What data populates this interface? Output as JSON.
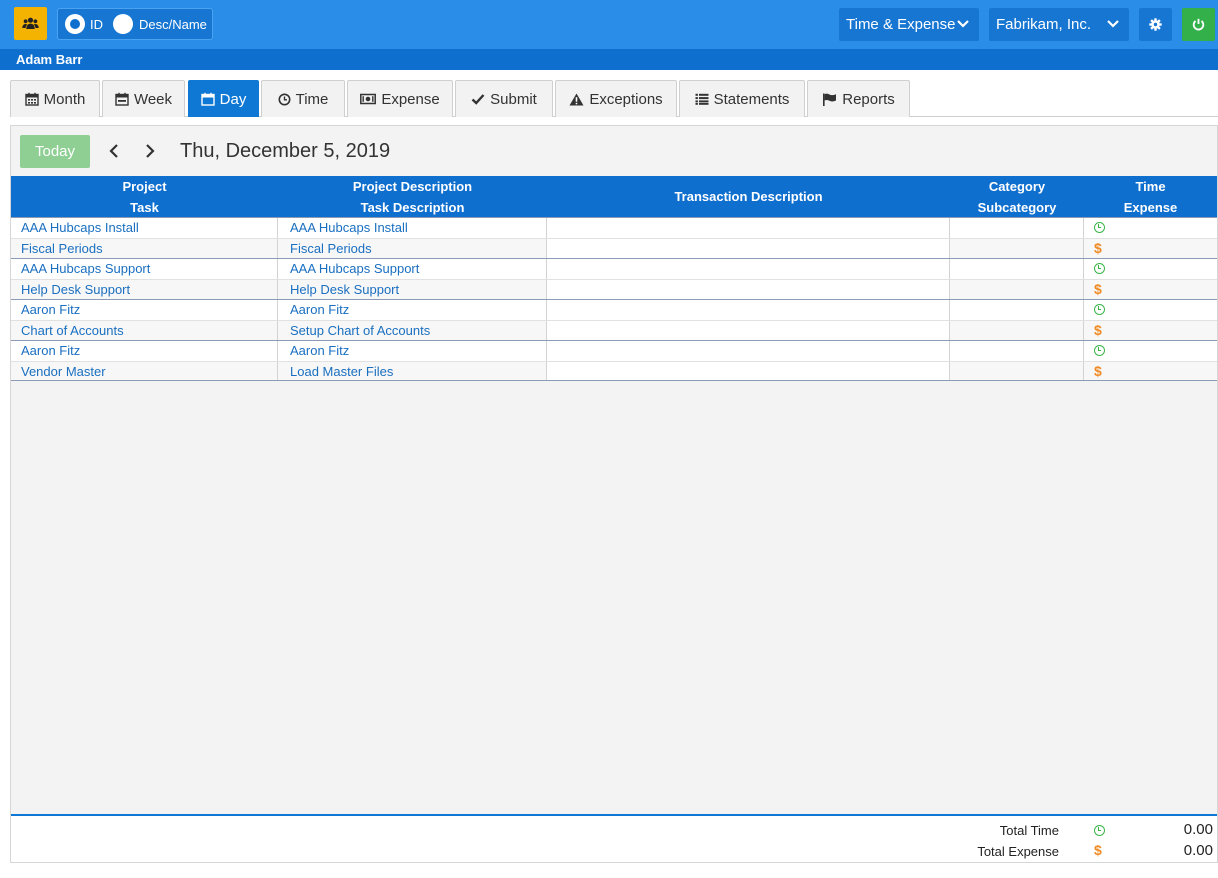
{
  "header": {
    "id_label": "ID",
    "desc_label": "Desc/Name",
    "module_label": "Time & Expense",
    "company_label": "Fabrikam, Inc.",
    "user_name": "Adam Barr",
    "accent_color": "#2a8ee8",
    "users_icon": "users-icon",
    "settings_icon": "gear-icon",
    "power_icon": "power-icon"
  },
  "tabs": [
    {
      "label": "Month",
      "icon": "calendar-icon",
      "active": false
    },
    {
      "label": "Week",
      "icon": "calendar-week-icon",
      "active": false
    },
    {
      "label": "Day",
      "icon": "calendar-day-icon",
      "active": true
    },
    {
      "label": "Time",
      "icon": "clock-icon",
      "active": false
    },
    {
      "label": "Expense",
      "icon": "money-icon",
      "active": false
    },
    {
      "label": "Submit",
      "icon": "check-icon",
      "active": false
    },
    {
      "label": "Exceptions",
      "icon": "warning-icon",
      "active": false
    },
    {
      "label": "Statements",
      "icon": "list-icon",
      "active": false
    },
    {
      "label": "Reports",
      "icon": "flag-icon",
      "active": false
    }
  ],
  "toolbar": {
    "today_label": "Today",
    "date_title": "Thu, December 5, 2019"
  },
  "grid": {
    "headers": {
      "project": "Project",
      "task": "Task",
      "project_desc": "Project Description",
      "task_desc": "Task Description",
      "transaction_desc": "Transaction Description",
      "category": "Category",
      "subcategory": "Subcategory",
      "time": "Time",
      "expense": "Expense"
    },
    "rows": [
      {
        "col1": "AAA Hubcaps Install",
        "col2": "AAA Hubcaps Install",
        "type": "time"
      },
      {
        "col1": "Fiscal Periods",
        "col2": "Fiscal Periods",
        "type": "expense"
      },
      {
        "col1": "AAA Hubcaps Support",
        "col2": "AAA Hubcaps Support",
        "type": "time"
      },
      {
        "col1": "Help Desk Support",
        "col2": "Help Desk Support",
        "type": "expense"
      },
      {
        "col1": "Aaron Fitz",
        "col2": "Aaron Fitz",
        "type": "time"
      },
      {
        "col1": "Chart of Accounts",
        "col2": "Setup Chart of Accounts",
        "type": "expense"
      },
      {
        "col1": "Aaron Fitz",
        "col2": "Aaron Fitz",
        "type": "time"
      },
      {
        "col1": "Vendor Master",
        "col2": "Load Master Files",
        "type": "expense"
      }
    ]
  },
  "totals": {
    "time_label": "Total Time",
    "time_value": "0.00",
    "expense_label": "Total Expense",
    "expense_value": "0.00",
    "dollar_symbol": "$"
  }
}
